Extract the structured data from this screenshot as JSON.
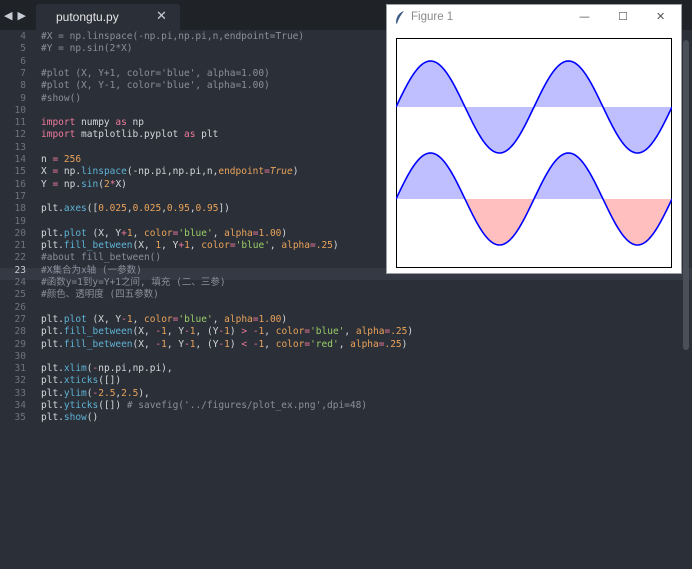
{
  "tab": {
    "title": "putongtu.py",
    "close": "✕"
  },
  "nav": {
    "back": "◀",
    "forward": "▶"
  },
  "editor": {
    "current_line": 23,
    "lines": [
      {
        "n": 4,
        "tokens": [
          [
            "cm",
            "#X = np.linspace(-np.pi,np.pi,n,endpoint=True)"
          ]
        ]
      },
      {
        "n": 5,
        "tokens": [
          [
            "cm",
            "#Y = np.sin(2*X)"
          ]
        ]
      },
      {
        "n": 6,
        "tokens": []
      },
      {
        "n": 7,
        "tokens": [
          [
            "cm",
            "#plot (X, Y+1, color='blue', alpha=1.00)"
          ]
        ]
      },
      {
        "n": 8,
        "tokens": [
          [
            "cm",
            "#plot (X, Y-1, color='blue', alpha=1.00)"
          ]
        ]
      },
      {
        "n": 9,
        "tokens": [
          [
            "cm",
            "#show()"
          ]
        ]
      },
      {
        "n": 10,
        "tokens": []
      },
      {
        "n": 11,
        "tokens": [
          [
            "kw",
            "import"
          ],
          [
            "ct",
            " numpy "
          ],
          [
            "kw",
            "as"
          ],
          [
            "ct",
            " np"
          ]
        ]
      },
      {
        "n": 12,
        "tokens": [
          [
            "kw",
            "import"
          ],
          [
            "ct",
            " matplotlib.pyplot "
          ],
          [
            "kw",
            "as"
          ],
          [
            "ct",
            " plt"
          ]
        ]
      },
      {
        "n": 13,
        "tokens": []
      },
      {
        "n": 14,
        "tokens": [
          [
            "ct",
            "n "
          ],
          [
            "op",
            "="
          ],
          [
            "ct",
            " "
          ],
          [
            "nm",
            "256"
          ]
        ]
      },
      {
        "n": 15,
        "tokens": [
          [
            "ct",
            "X "
          ],
          [
            "op",
            "="
          ],
          [
            "ct",
            " np."
          ],
          [
            "fn",
            "linspace"
          ],
          [
            "ct",
            "(-np.pi,np.pi,n,"
          ],
          [
            "nm",
            "endpoint"
          ],
          [
            "op",
            "="
          ],
          [
            "it",
            "True"
          ],
          [
            "ct",
            ")"
          ]
        ]
      },
      {
        "n": 16,
        "tokens": [
          [
            "ct",
            "Y "
          ],
          [
            "op",
            "="
          ],
          [
            "ct",
            " np."
          ],
          [
            "fn",
            "sin"
          ],
          [
            "ct",
            "("
          ],
          [
            "nm",
            "2"
          ],
          [
            "op",
            "*"
          ],
          [
            "ct",
            "X)"
          ]
        ]
      },
      {
        "n": 17,
        "tokens": []
      },
      {
        "n": 18,
        "tokens": [
          [
            "ct",
            "plt."
          ],
          [
            "fn",
            "axes"
          ],
          [
            "ct",
            "(["
          ],
          [
            "nm",
            "0.025"
          ],
          [
            "ct",
            ","
          ],
          [
            "nm",
            "0.025"
          ],
          [
            "ct",
            ","
          ],
          [
            "nm",
            "0.95"
          ],
          [
            "ct",
            ","
          ],
          [
            "nm",
            "0.95"
          ],
          [
            "ct",
            "])"
          ]
        ]
      },
      {
        "n": 19,
        "tokens": []
      },
      {
        "n": 20,
        "tokens": [
          [
            "ct",
            "plt."
          ],
          [
            "fn",
            "plot"
          ],
          [
            "ct",
            " (X, Y"
          ],
          [
            "op",
            "+"
          ],
          [
            "nm",
            "1"
          ],
          [
            "ct",
            ", "
          ],
          [
            "nm",
            "color"
          ],
          [
            "op",
            "="
          ],
          [
            "st",
            "'blue'"
          ],
          [
            "ct",
            ", "
          ],
          [
            "nm",
            "alpha"
          ],
          [
            "op",
            "="
          ],
          [
            "nm",
            "1.00"
          ],
          [
            "ct",
            ")"
          ]
        ]
      },
      {
        "n": 21,
        "tokens": [
          [
            "ct",
            "plt."
          ],
          [
            "fn",
            "fill_between"
          ],
          [
            "ct",
            "(X, "
          ],
          [
            "nm",
            "1"
          ],
          [
            "ct",
            ", Y"
          ],
          [
            "op",
            "+"
          ],
          [
            "nm",
            "1"
          ],
          [
            "ct",
            ", "
          ],
          [
            "nm",
            "color"
          ],
          [
            "op",
            "="
          ],
          [
            "st",
            "'blue'"
          ],
          [
            "ct",
            ", "
          ],
          [
            "nm",
            "alpha"
          ],
          [
            "op",
            "="
          ],
          [
            "nm",
            ".25"
          ],
          [
            "ct",
            ")"
          ]
        ]
      },
      {
        "n": 22,
        "tokens": [
          [
            "cm",
            "#about fill_between()"
          ]
        ]
      },
      {
        "n": 23,
        "tokens": [
          [
            "cm",
            "#X集合为x轴 (一参数)"
          ]
        ]
      },
      {
        "n": 24,
        "tokens": [
          [
            "cm",
            "#函数y=1到y=Y+1之间, 填充 (二、三参)"
          ]
        ]
      },
      {
        "n": 25,
        "tokens": [
          [
            "cm",
            "#颜色、透明度 (四五参数)"
          ]
        ]
      },
      {
        "n": 26,
        "tokens": []
      },
      {
        "n": 27,
        "tokens": [
          [
            "ct",
            "plt."
          ],
          [
            "fn",
            "plot"
          ],
          [
            "ct",
            " (X, Y"
          ],
          [
            "op",
            "-"
          ],
          [
            "nm",
            "1"
          ],
          [
            "ct",
            ", "
          ],
          [
            "nm",
            "color"
          ],
          [
            "op",
            "="
          ],
          [
            "st",
            "'blue'"
          ],
          [
            "ct",
            ", "
          ],
          [
            "nm",
            "alpha"
          ],
          [
            "op",
            "="
          ],
          [
            "nm",
            "1.00"
          ],
          [
            "ct",
            ")"
          ]
        ]
      },
      {
        "n": 28,
        "tokens": [
          [
            "ct",
            "plt."
          ],
          [
            "fn",
            "fill_between"
          ],
          [
            "ct",
            "(X, "
          ],
          [
            "op",
            "-"
          ],
          [
            "nm",
            "1"
          ],
          [
            "ct",
            ", Y"
          ],
          [
            "op",
            "-"
          ],
          [
            "nm",
            "1"
          ],
          [
            "ct",
            ", (Y"
          ],
          [
            "op",
            "-"
          ],
          [
            "nm",
            "1"
          ],
          [
            "ct",
            ") "
          ],
          [
            "op",
            ">"
          ],
          [
            "ct",
            " "
          ],
          [
            "op",
            "-"
          ],
          [
            "nm",
            "1"
          ],
          [
            "ct",
            ", "
          ],
          [
            "nm",
            "color"
          ],
          [
            "op",
            "="
          ],
          [
            "st",
            "'blue'"
          ],
          [
            "ct",
            ", "
          ],
          [
            "nm",
            "alpha"
          ],
          [
            "op",
            "="
          ],
          [
            "nm",
            ".25"
          ],
          [
            "ct",
            ")"
          ]
        ]
      },
      {
        "n": 29,
        "tokens": [
          [
            "ct",
            "plt."
          ],
          [
            "fn",
            "fill_between"
          ],
          [
            "ct",
            "(X, "
          ],
          [
            "op",
            "-"
          ],
          [
            "nm",
            "1"
          ],
          [
            "ct",
            ", Y"
          ],
          [
            "op",
            "-"
          ],
          [
            "nm",
            "1"
          ],
          [
            "ct",
            ", (Y"
          ],
          [
            "op",
            "-"
          ],
          [
            "nm",
            "1"
          ],
          [
            "ct",
            ") "
          ],
          [
            "op",
            "<"
          ],
          [
            "ct",
            " "
          ],
          [
            "op",
            "-"
          ],
          [
            "nm",
            "1"
          ],
          [
            "ct",
            ", "
          ],
          [
            "nm",
            "color"
          ],
          [
            "op",
            "="
          ],
          [
            "st",
            "'red'"
          ],
          [
            "ct",
            ", "
          ],
          [
            "nm",
            "alpha"
          ],
          [
            "op",
            "="
          ],
          [
            "nm",
            ".25"
          ],
          [
            "ct",
            ")"
          ]
        ]
      },
      {
        "n": 30,
        "tokens": []
      },
      {
        "n": 31,
        "tokens": [
          [
            "ct",
            "plt."
          ],
          [
            "fn",
            "xlim"
          ],
          [
            "ct",
            "("
          ],
          [
            "op",
            "-"
          ],
          [
            "ct",
            "np.pi,np.pi),"
          ]
        ]
      },
      {
        "n": 32,
        "tokens": [
          [
            "ct",
            "plt."
          ],
          [
            "fn",
            "xticks"
          ],
          [
            "ct",
            "([])"
          ]
        ]
      },
      {
        "n": 33,
        "tokens": [
          [
            "ct",
            "plt."
          ],
          [
            "fn",
            "ylim"
          ],
          [
            "ct",
            "("
          ],
          [
            "op",
            "-"
          ],
          [
            "nm",
            "2.5"
          ],
          [
            "ct",
            ","
          ],
          [
            "nm",
            "2.5"
          ],
          [
            "ct",
            "),"
          ]
        ]
      },
      {
        "n": 34,
        "tokens": [
          [
            "ct",
            "plt."
          ],
          [
            "fn",
            "yticks"
          ],
          [
            "ct",
            "([]) "
          ],
          [
            "cm",
            "# savefig('../figures/plot_ex.png',dpi=48)"
          ]
        ]
      },
      {
        "n": 35,
        "tokens": [
          [
            "ct",
            "plt."
          ],
          [
            "fn",
            "show"
          ],
          [
            "ct",
            "()"
          ]
        ]
      }
    ]
  },
  "figure": {
    "title": "Figure 1",
    "controls": {
      "minimize": "—",
      "maximize": "☐",
      "close": "✕"
    }
  },
  "chart_data": {
    "type": "area",
    "function": "sin(2x)",
    "xlim": [
      -3.14159,
      3.14159
    ],
    "ylim": [
      -2.5,
      2.5
    ],
    "xticks": [],
    "yticks": [],
    "grid": false,
    "series": [
      {
        "offset": 1,
        "line_color": "#0000ff",
        "fill_baseline": 1,
        "fill_color": "#0000ff",
        "fill_alpha": 0.25
      },
      {
        "offset": -1,
        "line_color": "#0000ff",
        "fill_baseline": -1,
        "fill_above_color": "#0000ff",
        "fill_below_color": "#ff0000",
        "fill_alpha": 0.25
      }
    ]
  }
}
